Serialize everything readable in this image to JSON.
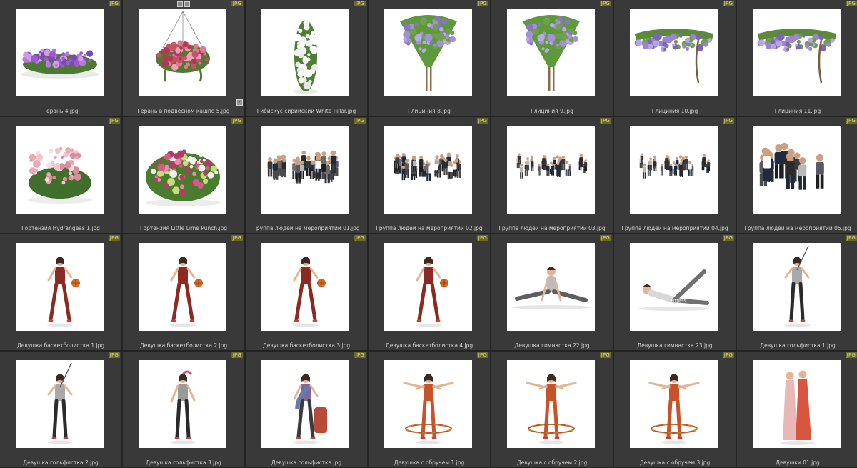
{
  "badge_label": "JPG",
  "colors": {
    "background": "#2b2b2b",
    "tile": "#393939",
    "badge": "#6a6a22",
    "caption": "#d0d0d0"
  },
  "items": [
    {
      "name": "Герань 4.jpg",
      "thumb": "flower-bush-purple"
    },
    {
      "name": "Герань в подвесном кашпо 5.jpg",
      "thumb": "hanging-basket",
      "selected": true
    },
    {
      "name": "Гибискус сирийский White Pillar.jpg",
      "thumb": "tall-shrub"
    },
    {
      "name": "Глициния 8.jpg",
      "thumb": "wisteria-tree"
    },
    {
      "name": "Глициния 9.jpg",
      "thumb": "wisteria-tree"
    },
    {
      "name": "Глициния 10.jpg",
      "thumb": "wisteria-vine"
    },
    {
      "name": "Глициния 11.jpg",
      "thumb": "wisteria-vine"
    },
    {
      "name": "Гортензия Hydrangeas 1.jpg",
      "thumb": "hydrangea-pink"
    },
    {
      "name": "Гортензия Little Lime Punch.jpg",
      "thumb": "hydrangea-bush"
    },
    {
      "name": "Группа людей на мероприятии 01.jpg",
      "thumb": "crowd-dense"
    },
    {
      "name": "Группа людей на мероприятии 02.jpg",
      "thumb": "crowd-medium"
    },
    {
      "name": "Группа людей на мероприятии 03.jpg",
      "thumb": "crowd-sparse"
    },
    {
      "name": "Группа людей на мероприятии 04.jpg",
      "thumb": "crowd-sparse"
    },
    {
      "name": "Группа людей на мероприятии 05.jpg",
      "thumb": "crowd-group"
    },
    {
      "name": "Девушка баскетболистка 1.jpg",
      "thumb": "basketball"
    },
    {
      "name": "Девушка баскетболистка 2.jpg",
      "thumb": "basketball"
    },
    {
      "name": "Девушка баскетболистка 3.jpg",
      "thumb": "basketball"
    },
    {
      "name": "Девушка баскетболистка 4.jpg",
      "thumb": "basketball"
    },
    {
      "name": "Девушка гимнастка 22.jpg",
      "thumb": "gymnast-split"
    },
    {
      "name": "Девушка гимнастка 23.jpg",
      "thumb": "gymnast-lying"
    },
    {
      "name": "Девушка гольфистка 1.jpg",
      "thumb": "golfer"
    },
    {
      "name": "Девушка гольфистка 2.jpg",
      "thumb": "golfer"
    },
    {
      "name": "Девушка гольфистка 3.jpg",
      "thumb": "golfer-standing"
    },
    {
      "name": "Девушка гольфистка.jpg",
      "thumb": "golfer-bag"
    },
    {
      "name": "Девушка с обручем 1.jpg",
      "thumb": "hoop-girl"
    },
    {
      "name": "Девушка с обручем 2.jpg",
      "thumb": "hoop-girl"
    },
    {
      "name": "Девушка с обручем 3.jpg",
      "thumb": "hoop-girl"
    },
    {
      "name": "Девушки 01.jpg",
      "thumb": "two-women"
    }
  ]
}
